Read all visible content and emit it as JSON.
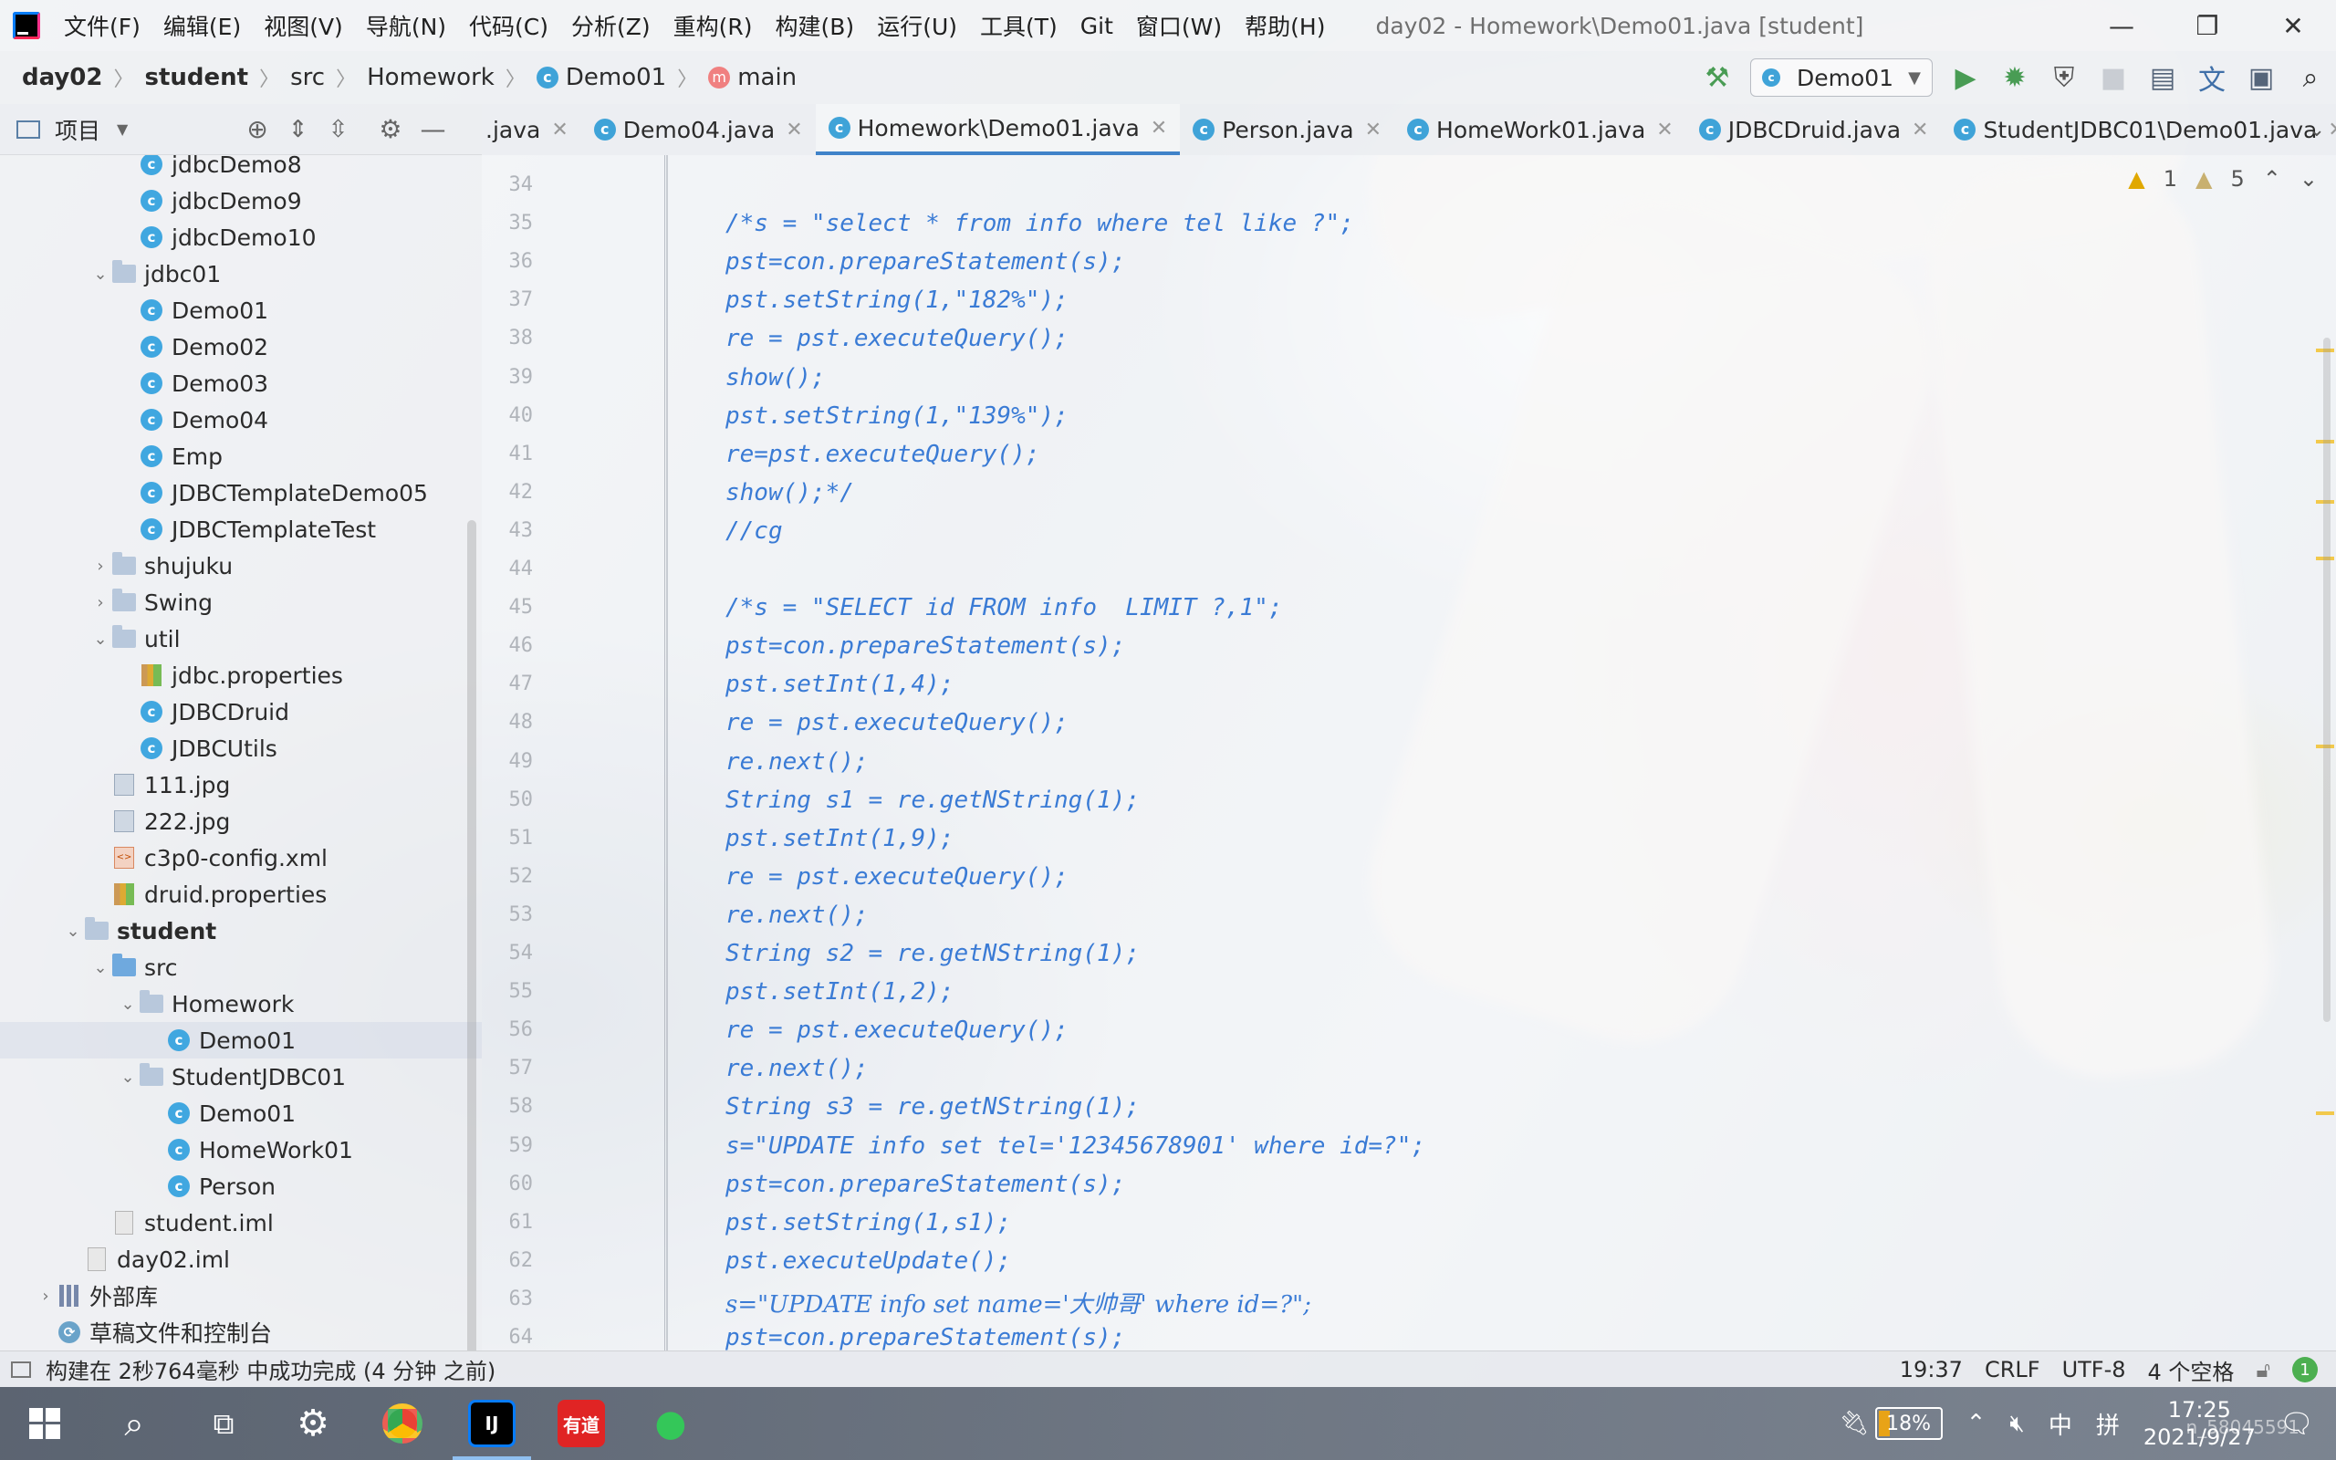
{
  "menubar": {
    "items": [
      "文件(F)",
      "编辑(E)",
      "视图(V)",
      "导航(N)",
      "代码(C)",
      "分析(Z)",
      "重构(R)",
      "构建(B)",
      "运行(U)",
      "工具(T)",
      "Git",
      "窗口(W)",
      "帮助(H)"
    ],
    "title": "day02 - Homework\\Demo01.java [student]"
  },
  "breadcrumb": {
    "items": [
      "day02",
      "student",
      "src",
      "Homework",
      "Demo01",
      "main"
    ]
  },
  "run_config": {
    "label": "Demo01"
  },
  "project_panel": {
    "title": "项目",
    "tree": [
      {
        "label": "jdbcDemo8",
        "icon": "class-icon",
        "indent": 4
      },
      {
        "label": "jdbcDemo9",
        "icon": "class-icon",
        "indent": 4
      },
      {
        "label": "jdbcDemo10",
        "icon": "class-icon",
        "indent": 4
      },
      {
        "label": "jdbc01",
        "icon": "folder-icon",
        "indent": 3,
        "chev": "open"
      },
      {
        "label": "Demo01",
        "icon": "class-icon",
        "indent": 4
      },
      {
        "label": "Demo02",
        "icon": "class-icon",
        "indent": 4
      },
      {
        "label": "Demo03",
        "icon": "class-icon",
        "indent": 4
      },
      {
        "label": "Demo04",
        "icon": "class-icon",
        "indent": 4
      },
      {
        "label": "Emp",
        "icon": "class-icon",
        "indent": 4
      },
      {
        "label": "JDBCTemplateDemo05",
        "icon": "class-icon",
        "indent": 4
      },
      {
        "label": "JDBCTemplateTest",
        "icon": "class-icon",
        "indent": 4
      },
      {
        "label": "shujuku",
        "icon": "folder-icon",
        "indent": 3,
        "chev": "closed"
      },
      {
        "label": "Swing",
        "icon": "folder-icon",
        "indent": 3,
        "chev": "closed"
      },
      {
        "label": "util",
        "icon": "folder-icon",
        "indent": 3,
        "chev": "open"
      },
      {
        "label": "jdbc.properties",
        "icon": "properties-icon",
        "indent": 4
      },
      {
        "label": "JDBCDruid",
        "icon": "class-icon",
        "indent": 4
      },
      {
        "label": "JDBCUtils",
        "icon": "class-icon",
        "indent": 4
      },
      {
        "label": "111.jpg",
        "icon": "image-icon",
        "indent": 3
      },
      {
        "label": "222.jpg",
        "icon": "image-icon",
        "indent": 3
      },
      {
        "label": "c3p0-config.xml",
        "icon": "xml-icon",
        "indent": 3
      },
      {
        "label": "druid.properties",
        "icon": "properties-icon",
        "indent": 3
      },
      {
        "label": "student",
        "icon": "module-folder-icon",
        "indent": 2,
        "chev": "open",
        "bold": true
      },
      {
        "label": "src",
        "icon": "source-folder-icon",
        "indent": 3,
        "chev": "open"
      },
      {
        "label": "Homework",
        "icon": "folder-icon",
        "indent": 4,
        "chev": "open"
      },
      {
        "label": "Demo01",
        "icon": "class-icon",
        "indent": 5,
        "selected": true
      },
      {
        "label": "StudentJDBC01",
        "icon": "folder-icon",
        "indent": 4,
        "chev": "open"
      },
      {
        "label": "Demo01",
        "icon": "class-icon",
        "indent": 5
      },
      {
        "label": "HomeWork01",
        "icon": "class-icon",
        "indent": 5
      },
      {
        "label": "Person",
        "icon": "class-icon",
        "indent": 5
      },
      {
        "label": "student.iml",
        "icon": "file-icon",
        "indent": 3
      },
      {
        "label": "day02.iml",
        "icon": "file-icon",
        "indent": 2
      },
      {
        "label": "外部库",
        "icon": "library-icon",
        "indent": 1,
        "chev": "closed"
      },
      {
        "label": "草稿文件和控制台",
        "icon": "scratch-icon",
        "indent": 1
      }
    ]
  },
  "tabs": [
    {
      "label": ".java",
      "active": false
    },
    {
      "label": "Demo04.java",
      "active": false
    },
    {
      "label": "Homework\\Demo01.java",
      "active": true
    },
    {
      "label": "Person.java",
      "active": false
    },
    {
      "label": "HomeWork01.java",
      "active": false
    },
    {
      "label": "JDBCDruid.java",
      "active": false
    },
    {
      "label": "StudentJDBC01\\Demo01.java",
      "active": false
    }
  ],
  "inspections": {
    "warnings": "1",
    "weak_warnings": "5"
  },
  "editor": {
    "lines": [
      {
        "n": "34",
        "code": ""
      },
      {
        "n": "35",
        "code": "/*s = \"select * from info where tel like ?\";"
      },
      {
        "n": "36",
        "code": "pst=con.prepareStatement(s);"
      },
      {
        "n": "37",
        "code": "pst.setString(1,\"182%\");"
      },
      {
        "n": "38",
        "code": "re = pst.executeQuery();"
      },
      {
        "n": "39",
        "code": "show();"
      },
      {
        "n": "40",
        "code": "pst.setString(1,\"139%\");"
      },
      {
        "n": "41",
        "code": "re=pst.executeQuery();"
      },
      {
        "n": "42",
        "code": "show();*/"
      },
      {
        "n": "43",
        "code": "//cg"
      },
      {
        "n": "44",
        "code": ""
      },
      {
        "n": "45",
        "code": "/*s = \"SELECT id FROM info  LIMIT ?,1\";"
      },
      {
        "n": "46",
        "code": "pst=con.prepareStatement(s);"
      },
      {
        "n": "47",
        "code": "pst.setInt(1,4);"
      },
      {
        "n": "48",
        "code": "re = pst.executeQuery();"
      },
      {
        "n": "49",
        "code": "re.next();"
      },
      {
        "n": "50",
        "code": "String s1 = re.getNString(1);"
      },
      {
        "n": "51",
        "code": "pst.setInt(1,9);"
      },
      {
        "n": "52",
        "code": "re = pst.executeQuery();"
      },
      {
        "n": "53",
        "code": "re.next();"
      },
      {
        "n": "54",
        "code": "String s2 = re.getNString(1);"
      },
      {
        "n": "55",
        "code": "pst.setInt(1,2);"
      },
      {
        "n": "56",
        "code": "re = pst.executeQuery();"
      },
      {
        "n": "57",
        "code": "re.next();"
      },
      {
        "n": "58",
        "code": "String s3 = re.getNString(1);"
      },
      {
        "n": "59",
        "code": "s=\"UPDATE info set tel='12345678901' where id=?\";"
      },
      {
        "n": "60",
        "code": "pst=con.prepareStatement(s);"
      },
      {
        "n": "61",
        "code": "pst.setString(1,s1);"
      },
      {
        "n": "62",
        "code": "pst.executeUpdate();"
      },
      {
        "n": "63",
        "code": "s=\"UPDATE info set name='大帅哥' where id=?\";"
      },
      {
        "n": "64",
        "code": "pst=con.prepareStatement(s);"
      }
    ]
  },
  "statusbar": {
    "message": "构建在 2秒764毫秒 中成功完成 (4 分钟 之前)",
    "position": "19:37",
    "line_sep": "CRLF",
    "encoding": "UTF-8",
    "indent": "4 个空格",
    "notifications": "1"
  },
  "taskbar": {
    "apps": [
      {
        "name": "start-button"
      },
      {
        "name": "search-button"
      },
      {
        "name": "task-view-button"
      },
      {
        "name": "settings-app"
      },
      {
        "name": "browser-app"
      },
      {
        "name": "intellij-app",
        "active": true
      },
      {
        "name": "youdao-app",
        "label": "有道"
      },
      {
        "name": "wechat-app"
      }
    ],
    "battery": "18%",
    "ime_lang": "中",
    "ime_mode": "拼",
    "time": "17:25",
    "date": "2021/9/27",
    "watermark": "n_58045591"
  },
  "colors": {
    "code": "#3a7bd5",
    "accent": "#4083c9",
    "run": "#499c54"
  }
}
